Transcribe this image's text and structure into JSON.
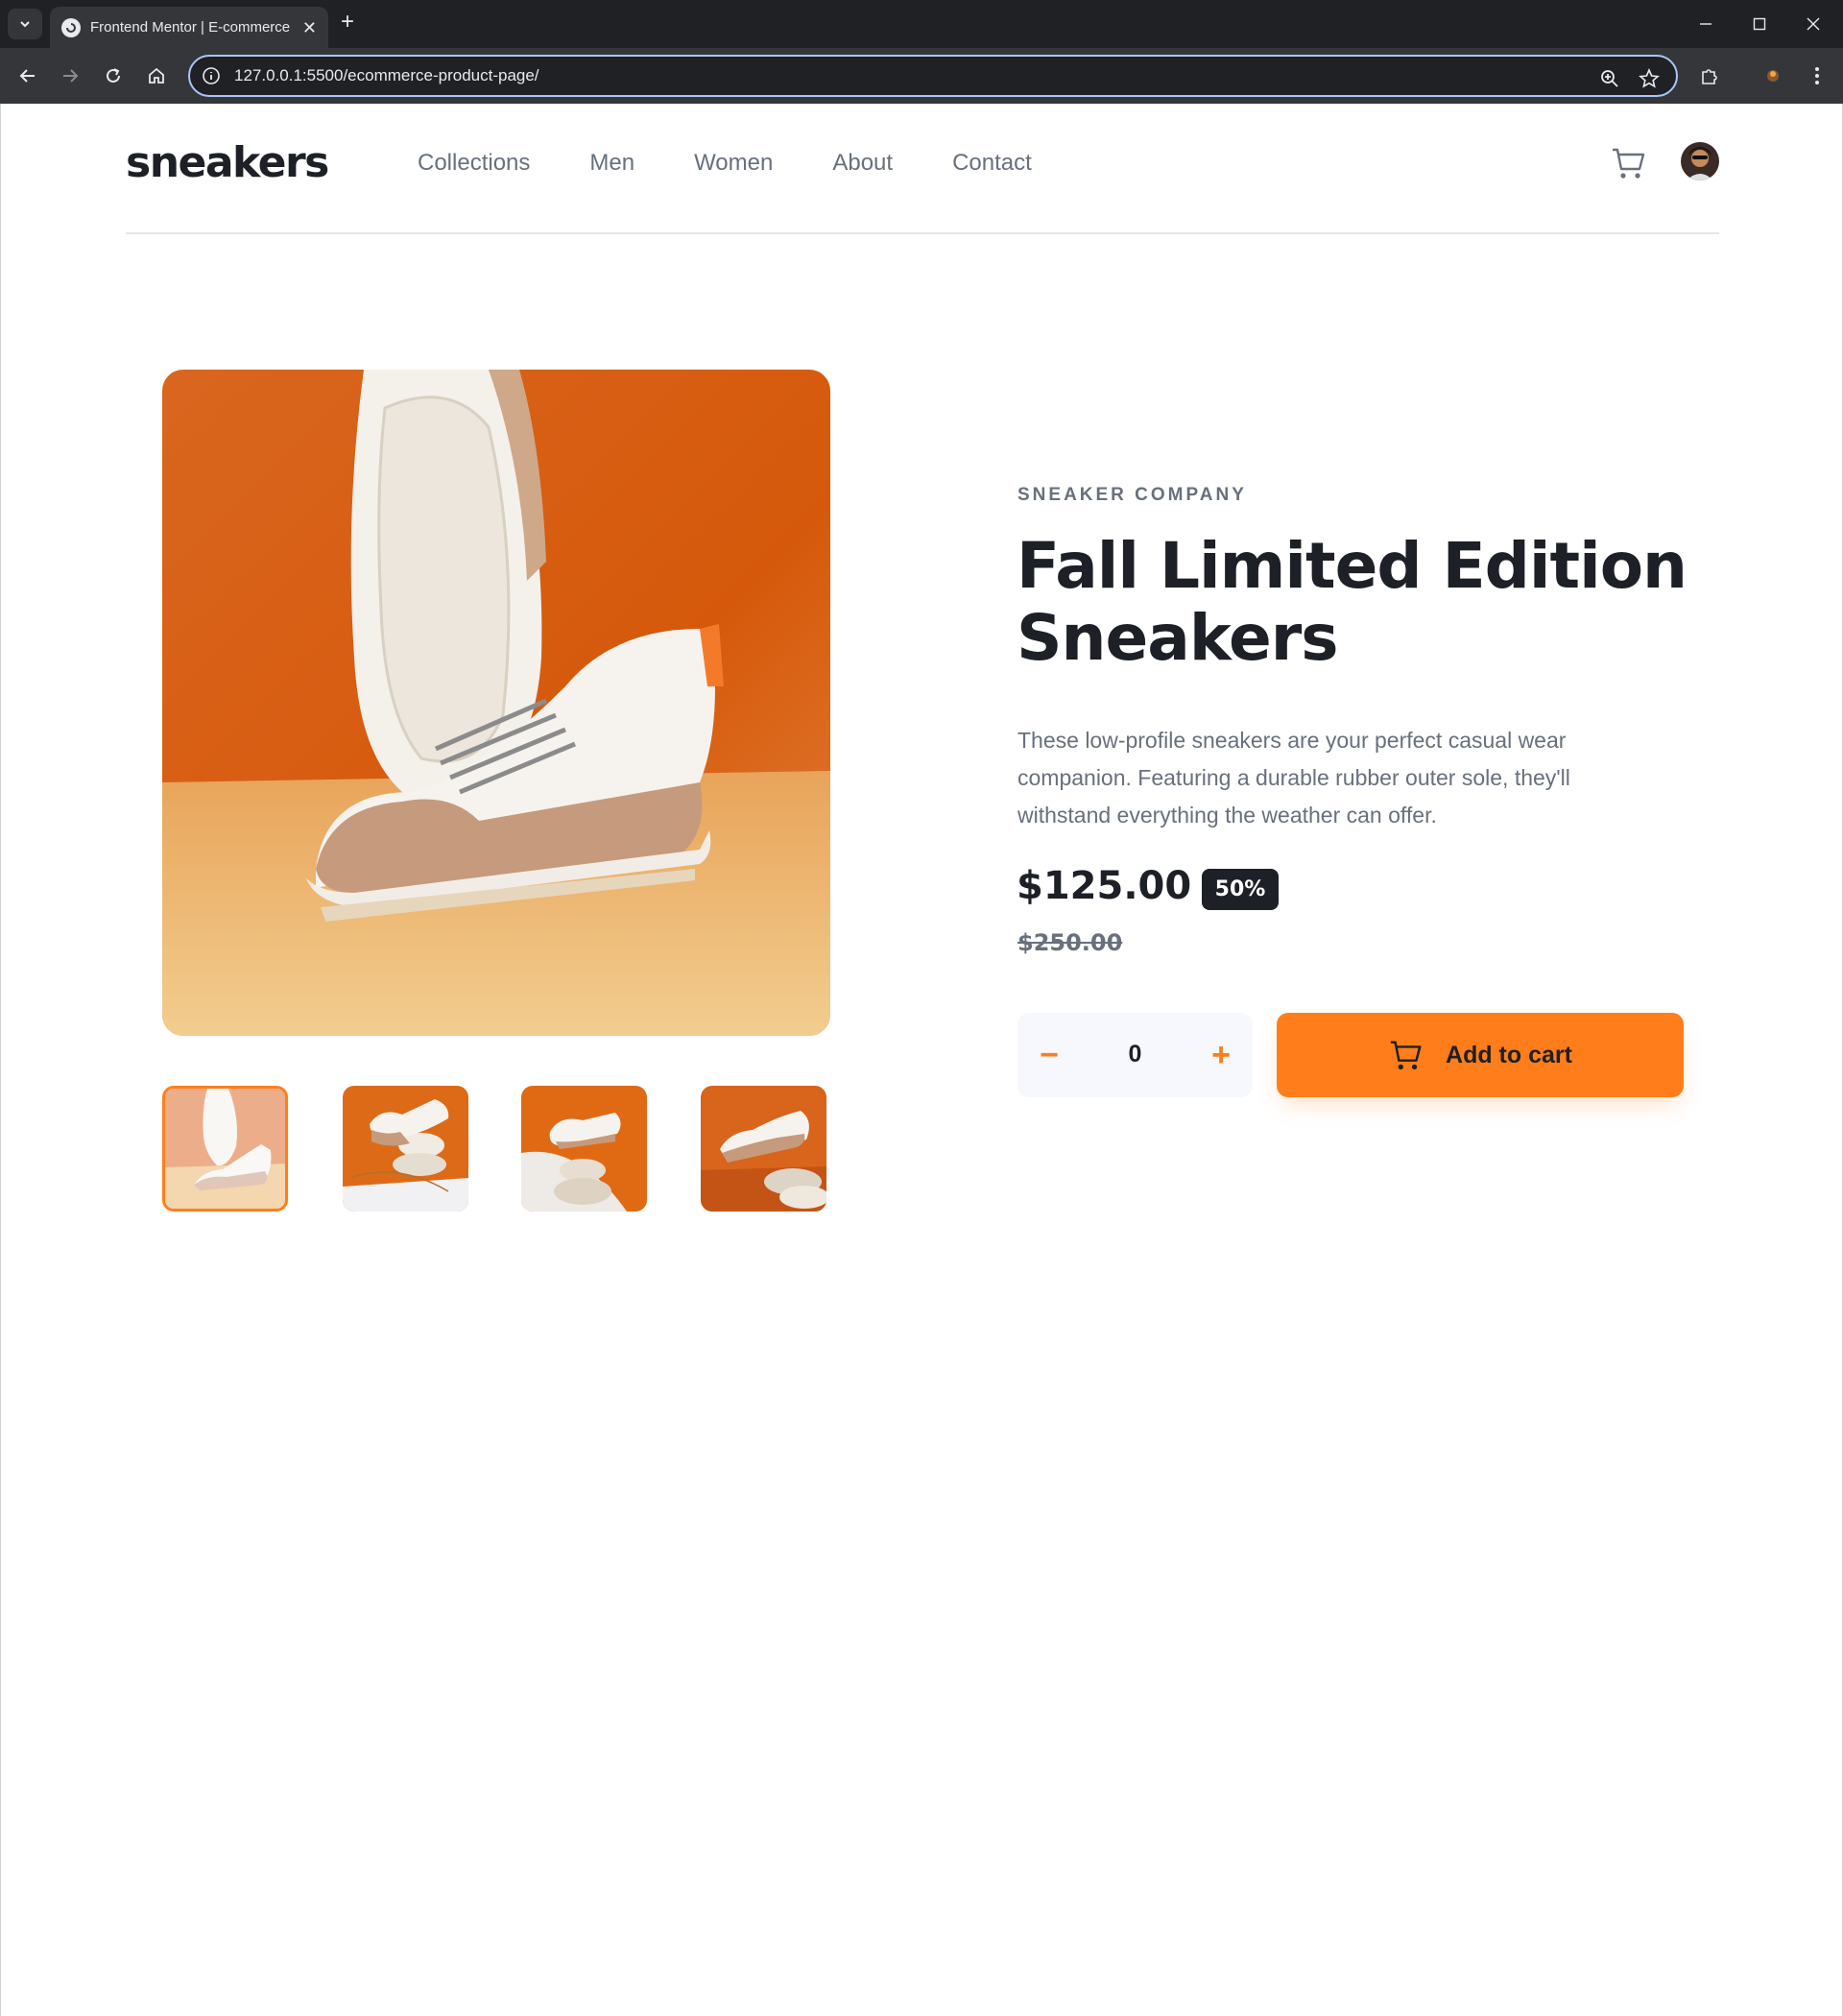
{
  "browser": {
    "tab_title": "Frontend Mentor | E-commerce",
    "url": "127.0.0.1:5500/ecommerce-product-page/"
  },
  "header": {
    "logo": "sneakers",
    "nav": [
      "Collections",
      "Men",
      "Women",
      "About",
      "Contact"
    ]
  },
  "product": {
    "company": "SNEAKER COMPANY",
    "title": "Fall Limited Edition Sneakers",
    "description": "These low-profile sneakers are your perfect casual wear companion. Featuring a durable rubber outer sole, they'll withstand everything the weather can offer.",
    "price": "$125.00",
    "discount": "50%",
    "original_price": "$250.00",
    "quantity": "0",
    "minus_label": "−",
    "plus_label": "+",
    "add_to_cart": "Add to cart"
  },
  "gallery": {
    "selected_thumbnail": 1,
    "thumbnail_count": 4
  },
  "colors": {
    "accent": "#ff7e1b",
    "dark": "#1d2026",
    "muted_text": "#68707d",
    "qty_background": "#f6f8fd"
  }
}
